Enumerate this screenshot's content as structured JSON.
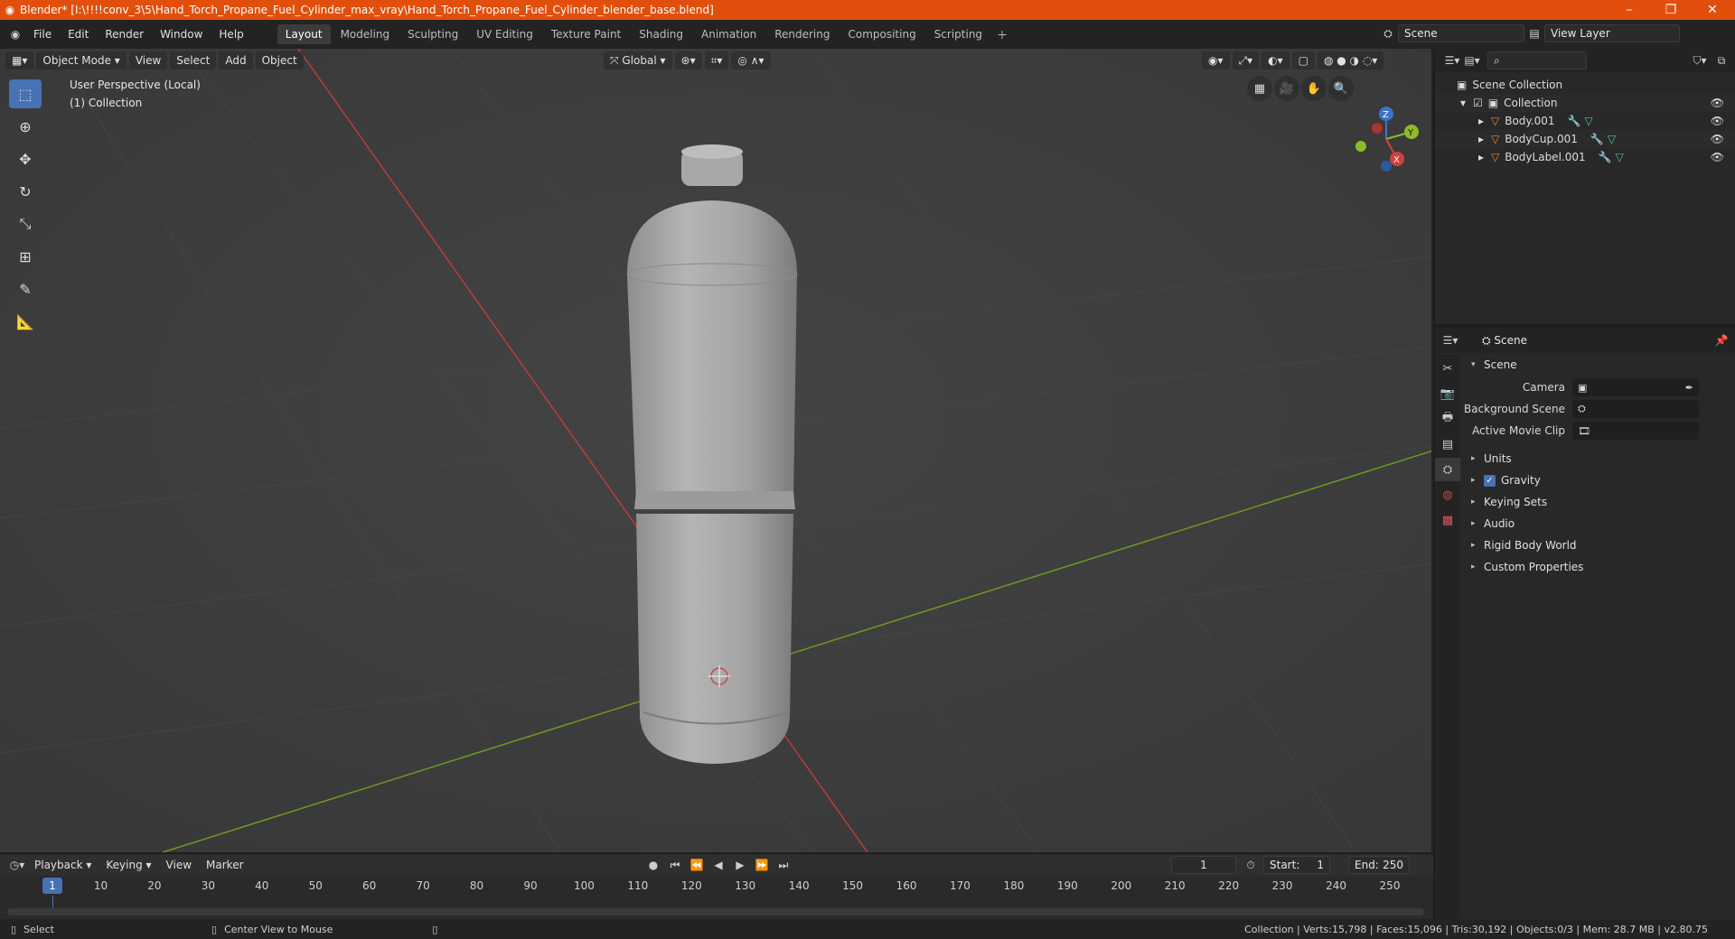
{
  "title": "Blender* [I:\\!!!!conv_3\\5\\Hand_Torch_Propane_Fuel_Cylinder_max_vray\\Hand_Torch_Propane_Fuel_Cylinder_blender_base.blend]",
  "menu": [
    "File",
    "Edit",
    "Render",
    "Window",
    "Help"
  ],
  "workspaces": [
    "Layout",
    "Modeling",
    "Sculpting",
    "UV Editing",
    "Texture Paint",
    "Shading",
    "Animation",
    "Rendering",
    "Compositing",
    "Scripting"
  ],
  "active_workspace": "Layout",
  "scene_field": "Scene",
  "view_layer_field": "View Layer",
  "viewport": {
    "mode": "Object Mode",
    "menus": [
      "View",
      "Select",
      "Add",
      "Object"
    ],
    "transform_orientation": "Global",
    "info_line1": "User Perspective (Local)",
    "info_line2": "(1) Collection",
    "axis_x": "X",
    "axis_y": "Y",
    "axis_z": "Z"
  },
  "outliner": {
    "rows": [
      {
        "label": "Scene Collection"
      },
      {
        "label": "Collection"
      },
      {
        "label": "Body.001"
      },
      {
        "label": "BodyCup.001"
      },
      {
        "label": "BodyLabel.001"
      }
    ]
  },
  "properties": {
    "header": "Scene",
    "panel": "Scene",
    "camera_label": "Camera",
    "background_scene_label": "Background Scene",
    "active_movie_clip_label": "Active Movie Clip",
    "sections": [
      "Units",
      "Gravity",
      "Keying Sets",
      "Audio",
      "Rigid Body World",
      "Custom Properties"
    ],
    "gravity_checked": true
  },
  "timeline": {
    "menus": [
      "Playback",
      "Keying",
      "View",
      "Marker"
    ],
    "current_frame": "1",
    "start_label": "Start:",
    "start": "1",
    "end_label": "End:",
    "end": "250",
    "ticks": [
      "1",
      "10",
      "20",
      "30",
      "40",
      "50",
      "60",
      "70",
      "80",
      "90",
      "100",
      "110",
      "120",
      "130",
      "140",
      "150",
      "160",
      "170",
      "180",
      "190",
      "200",
      "210",
      "220",
      "230",
      "240",
      "250"
    ]
  },
  "status": {
    "select": "Select",
    "center_view": "Center View to Mouse",
    "stats": "Collection | Verts:15,798 | Faces:15,096 | Tris:30,192 | Objects:0/3 | Mem: 28.7 MB | v2.80.75"
  },
  "colors": {
    "title_bar": "#e24f0d",
    "accent": "#4772b3",
    "x_axis": "#c23a3a",
    "y_axis": "#6e9b1e",
    "mesh_icon": "#e58b2e"
  }
}
